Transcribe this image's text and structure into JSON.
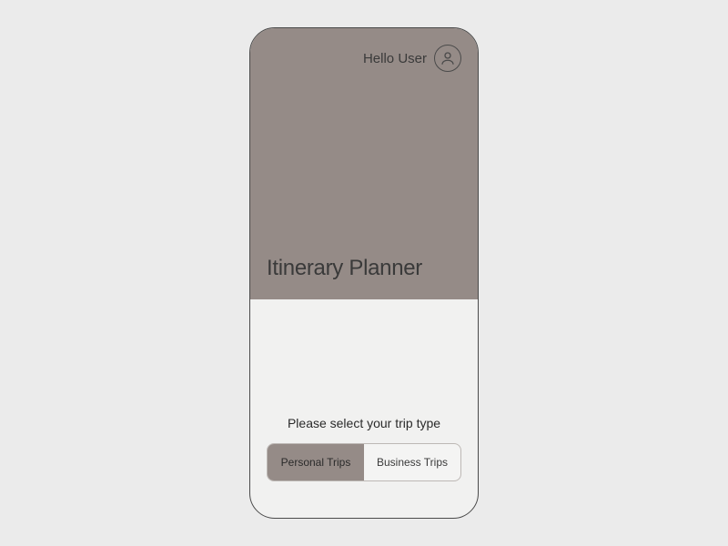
{
  "header": {
    "greeting": "Hello User",
    "title": "Itinerary Planner"
  },
  "trip_selection": {
    "prompt": "Please select your trip type",
    "options": [
      {
        "label": "Personal Trips",
        "selected": true
      },
      {
        "label": "Business Trips",
        "selected": false
      }
    ]
  },
  "colors": {
    "panel_bg": "#958b87",
    "frame_bg": "#f1f1f0",
    "page_bg": "#ebebeb"
  }
}
